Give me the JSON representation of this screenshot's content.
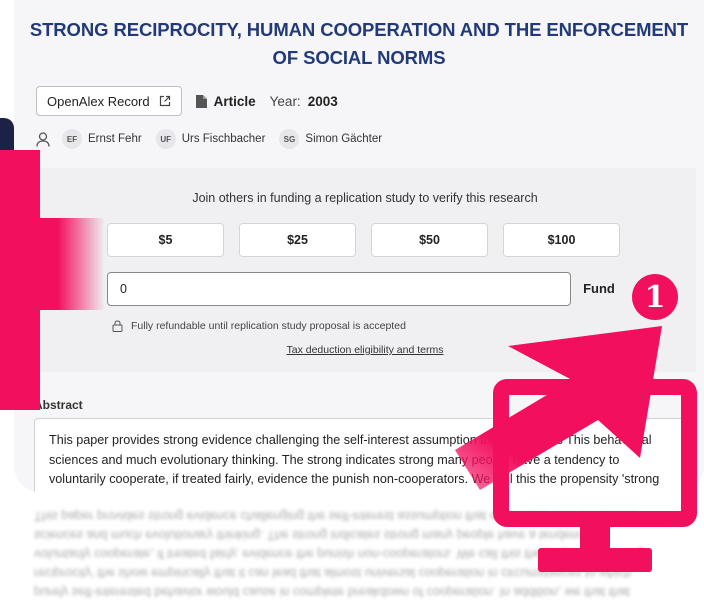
{
  "paper": {
    "title_line1": "STRONG RECIPROCITY, HUMAN COOPERATION AND THE ENFORCEMENT",
    "title_line2": "OF SOCIAL NORMS",
    "openalex_label": "OpenAlex Record",
    "type": "Article",
    "year_label": "Year:",
    "year": "2003"
  },
  "authors": [
    {
      "initials": "EF",
      "name": "Ernst Fehr"
    },
    {
      "initials": "UF",
      "name": "Urs Fischbacher"
    },
    {
      "initials": "SG",
      "name": "Simon Gächter"
    }
  ],
  "funding": {
    "heading": "Join others in funding a replication study to verify this research",
    "amounts": [
      "$5",
      "$25",
      "$50",
      "$100"
    ],
    "input_value": "0",
    "fund_label": "Fund",
    "refund_note": "Fully refundable until replication study proposal is accepted",
    "tax_link": "Tax deduction eligibility and terms"
  },
  "abstract": {
    "label": "Abstract",
    "lines": [
      "This paper provides strong evidence challenging the self-interest assumption that dominates This behavioral",
      "sciences and much evolutionary thinking. The strong indicates strong many people have a tendency to",
      "voluntarily cooperate, if treated fairly, evidence the punish non-cooperators. We call this the propensity 'strong",
      "reciprocity' the show empirically that it can lead that almost universal cooperation in circumstances to which",
      "purely self-interested behavior would cause in complete breakdown of cooperation. In addition, we that that"
    ]
  },
  "annotation": {
    "step_number": "1",
    "accent_color": "#f20f5e"
  }
}
